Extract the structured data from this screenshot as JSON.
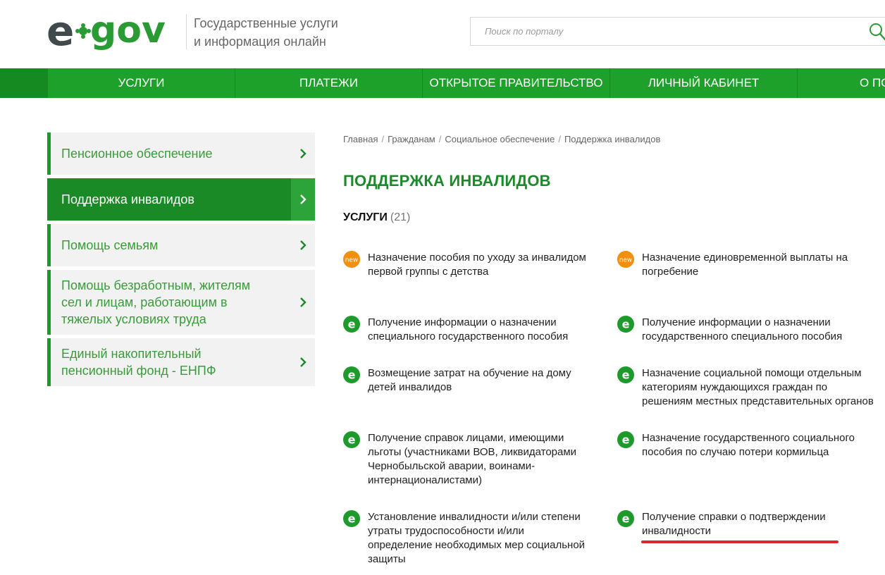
{
  "header": {
    "tagline_line1": "Государственные услуги",
    "tagline_line2": "и информация онлайн",
    "search_placeholder": "Поиск по порталу"
  },
  "nav": {
    "items": [
      {
        "label": "Услуги"
      },
      {
        "label": "Платежи"
      },
      {
        "label": "Открытое правительство"
      },
      {
        "label": "Личный кабинет"
      },
      {
        "label": "О по"
      }
    ]
  },
  "sidebar": {
    "items": [
      {
        "label": "Пенсионное обеспечение",
        "active": false
      },
      {
        "label": "Поддержка инвалидов",
        "active": true
      },
      {
        "label": "Помощь семьям",
        "active": false
      },
      {
        "label": "Помощь безработным, жителям сел и лицам, работающим в тяжелых условиях труда",
        "active": false
      },
      {
        "label": "Единый накопительный пенсионный фонд - ЕНПФ",
        "active": false
      }
    ]
  },
  "breadcrumb": {
    "items": [
      "Главная",
      "Гражданам",
      "Социальное обеспечение",
      "Поддержка инвалидов"
    ]
  },
  "page": {
    "title": "ПОДДЕРЖКА ИНВАЛИДОВ",
    "services_label": "УСЛУГИ",
    "services_count": "(21)"
  },
  "services": [
    {
      "icon": "new-badge-icon",
      "badge": "new",
      "text": "Назначение пособия по уходу за инвалидом первой группы с детства"
    },
    {
      "icon": "new-badge-icon",
      "badge": "new",
      "text": "Назначение единовременной выплаты на погребение"
    },
    {
      "icon": "egov-e-icon",
      "badge": "e",
      "text": "Получение информации о назначении специального государственного пособия"
    },
    {
      "icon": "egov-e-icon",
      "badge": "e",
      "text": "Получение информации о назначении государственного специального пособия"
    },
    {
      "icon": "egov-e-icon",
      "badge": "e",
      "text": "Возмещение затрат на обучение на дому детей инвалидов"
    },
    {
      "icon": "egov-e-icon",
      "badge": "e",
      "text": "Назначение социальной помощи отдельным категориям нуждающихся граждан по решениям местных представительных органов"
    },
    {
      "icon": "egov-e-icon",
      "badge": "e",
      "text": "Получение справок лицами, имеющими льготы (участниками ВОВ, ликвидаторами Чернобыльской аварии, воинами-интернационалистами)"
    },
    {
      "icon": "egov-e-icon",
      "badge": "e",
      "text": "Назначение государственного социального пособия по случаю потери кормильца"
    },
    {
      "icon": "egov-e-icon",
      "badge": "e",
      "text": "Установление инвалидности и/или степени утраты трудоспособности и/или определение необходимых мер социальной защиты"
    },
    {
      "icon": "egov-e-icon",
      "badge": "e",
      "text": "Получение справки о подтверждении инвалидности"
    }
  ],
  "colors": {
    "brand_green": "#1ea12a",
    "dark_green": "#148a20",
    "title_green": "#1c8a2a",
    "new_badge_orange": "#f0900e",
    "highlight_red": "#e0262d"
  }
}
